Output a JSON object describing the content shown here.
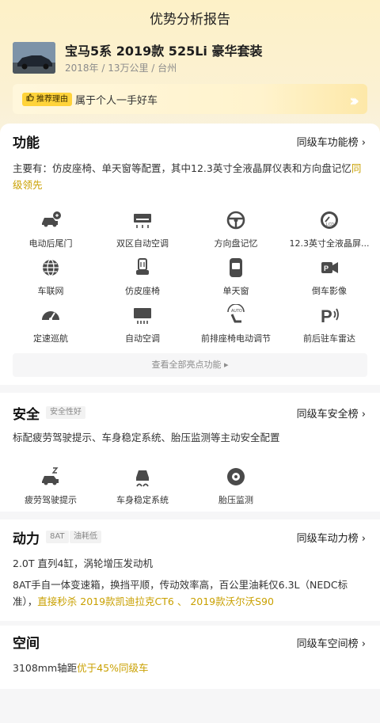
{
  "header": {
    "title": "优势分析报告"
  },
  "car": {
    "name": "宝马5系 2019款 525Li 豪华套装",
    "meta": "2018年 / 13万公里 / 台州"
  },
  "reason": {
    "tag": "推荐理由",
    "text": "属于个人一手好车"
  },
  "function": {
    "title": "功能",
    "link": "同级车功能榜 ›",
    "desc_prefix": "主要有：仿皮座椅、单天窗等配置，其中12.3英寸全液晶屏仪表和方向盘记忆",
    "desc_highlight": "同级领先",
    "items": [
      {
        "label": "电动后尾门",
        "icon": "power-tailgate-icon"
      },
      {
        "label": "双区自动空调",
        "icon": "dual-zone-ac-icon"
      },
      {
        "label": "方向盘记忆",
        "icon": "steering-memory-icon"
      },
      {
        "label": "12.3英寸全液晶屏...",
        "icon": "lcd-display-icon"
      },
      {
        "label": "车联网",
        "icon": "connected-car-icon"
      },
      {
        "label": "仿皮座椅",
        "icon": "leather-seat-icon"
      },
      {
        "label": "单天窗",
        "icon": "sunroof-icon"
      },
      {
        "label": "倒车影像",
        "icon": "reverse-camera-icon"
      },
      {
        "label": "定速巡航",
        "icon": "cruise-control-icon"
      },
      {
        "label": "自动空调",
        "icon": "auto-ac-icon"
      },
      {
        "label": "前排座椅电动调节",
        "icon": "power-seat-icon"
      },
      {
        "label": "前后驻车雷达",
        "icon": "parking-radar-icon"
      }
    ],
    "view_all": "查看全部亮点功能 ▸"
  },
  "safety": {
    "title": "安全",
    "chip": "安全性好",
    "link": "同级车安全榜 ›",
    "desc": "标配疲劳驾驶提示、车身稳定系统、胎压监测等主动安全配置",
    "items": [
      {
        "label": "疲劳驾驶提示",
        "icon": "fatigue-alert-icon"
      },
      {
        "label": "车身稳定系统",
        "icon": "stability-control-icon"
      },
      {
        "label": "胎压监测",
        "icon": "tire-pressure-icon"
      }
    ]
  },
  "power": {
    "title": "动力",
    "chips": [
      "8AT",
      "油耗低"
    ],
    "link": "同级车动力榜 ›",
    "line1": "2.0T 直列4缸，涡轮增压发动机",
    "line2_prefix": "8AT手自一体变速箱，换挡平顺，传动效率高，百公里油耗仅6.3L（NEDC标准），",
    "line2_highlight": "直接秒杀 2019款凯迪拉克CT6 、 2019款沃尔沃S90"
  },
  "space": {
    "title": "空间",
    "link": "同级车空间榜 ›",
    "desc_prefix": "3108mm轴距",
    "desc_highlight": "优于45%同级车"
  },
  "colors": {
    "accent": "#c9a000",
    "tag": "#ffd33a",
    "icon": "#4a4a4a"
  }
}
